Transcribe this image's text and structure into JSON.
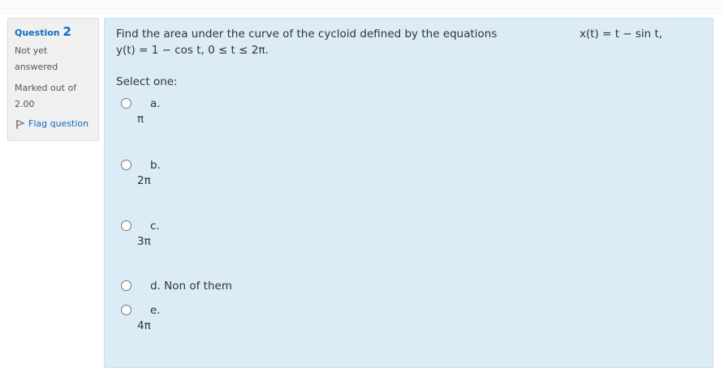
{
  "info": {
    "question_label": "Question",
    "question_number": "2",
    "state": "Not yet answered",
    "grade": "Marked out of 2.00",
    "flag_label": "Flag question"
  },
  "question": {
    "text_line1": "Find the area under the curve of the cycloid defined by the equations",
    "eq_x": "x(t) = t − sin t,",
    "text_line2": "y(t) = 1 − cos t, 0 ≤ t ≤ 2π.",
    "prompt": "Select one:"
  },
  "options": [
    {
      "letter": "a.",
      "value": "π"
    },
    {
      "letter": "b.",
      "value": "2π"
    },
    {
      "letter": "c.",
      "value": "3π"
    },
    {
      "letter": "d. Non of them",
      "value": ""
    },
    {
      "letter": "e.",
      "value": "4π"
    }
  ],
  "colors": {
    "link": "#0f6cbf",
    "content_bg": "#dbecf6",
    "info_bg": "#f0f0f0"
  }
}
